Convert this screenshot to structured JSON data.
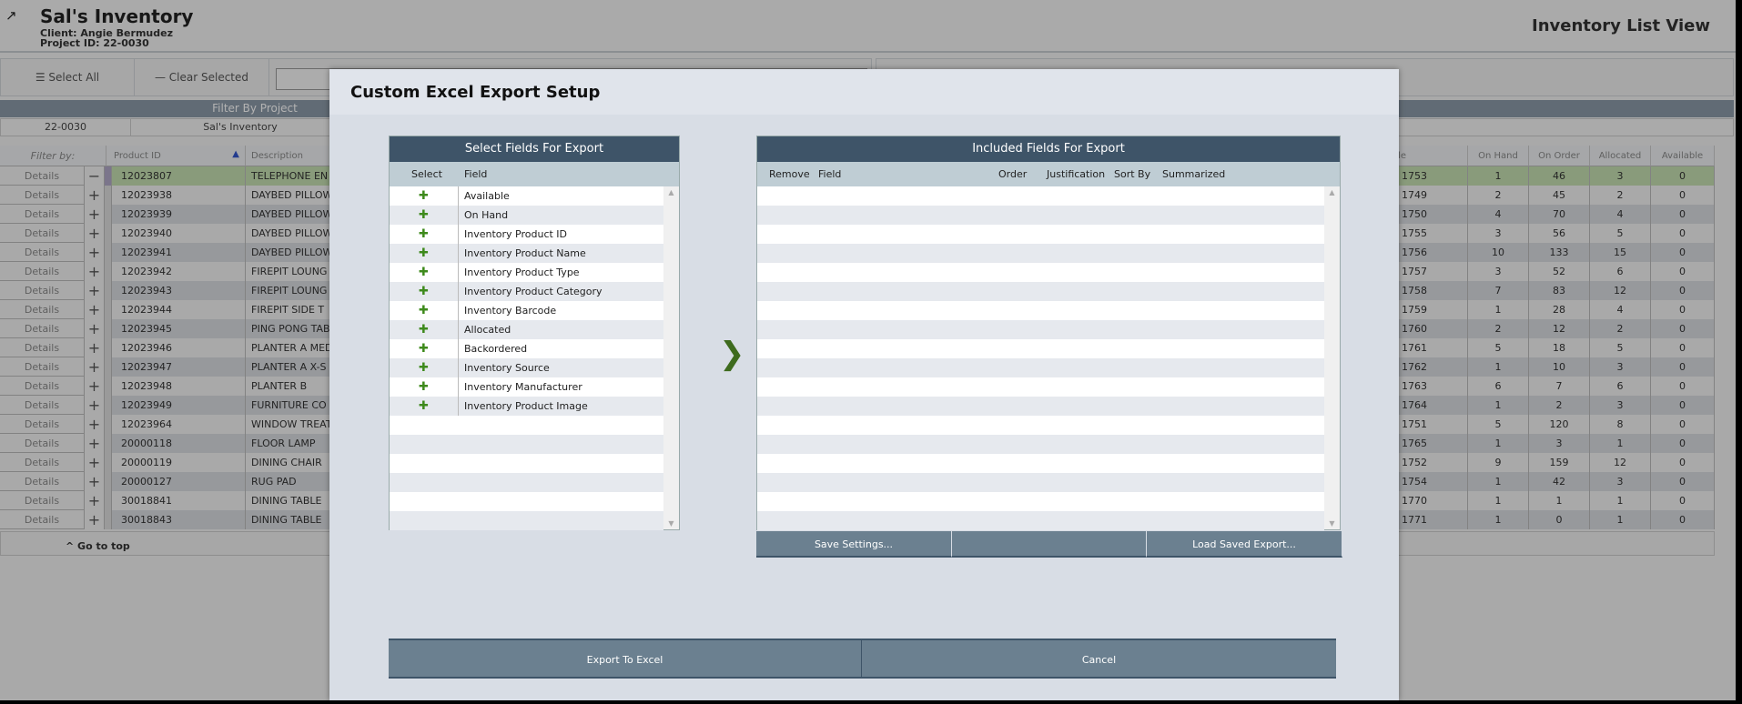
{
  "header": {
    "title": "Sal's Inventory",
    "client": "Client: Angie Bermudez",
    "project": "Project ID: 22-0030",
    "view_title": "Inventory List View"
  },
  "toolbar": {
    "select_all": "Select All",
    "clear_selected": "Clear Selected"
  },
  "filter": {
    "label": "Filter By Project",
    "project_id": "22-0030",
    "project_name": "Sal's Inventory"
  },
  "grid": {
    "headers": {
      "filter_by": "Filter by:",
      "product_id": "Product ID",
      "description": "Description",
      "barcode": "Barcode",
      "on_hand": "On Hand",
      "on_order": "On Order",
      "allocated": "Allocated",
      "available": "Available"
    },
    "details_label": "Details",
    "rows": [
      {
        "id": "12023807",
        "desc": "TELEPHONE EN",
        "code": "1753",
        "oh": "1",
        "oo": "46",
        "al": "3",
        "av": "0",
        "selected": true
      },
      {
        "id": "12023938",
        "desc": "DAYBED PILLOW",
        "code": "1749",
        "oh": "2",
        "oo": "45",
        "al": "2",
        "av": "0"
      },
      {
        "id": "12023939",
        "desc": "DAYBED PILLOW",
        "code": "1750",
        "oh": "4",
        "oo": "70",
        "al": "4",
        "av": "0"
      },
      {
        "id": "12023940",
        "desc": "DAYBED PILLOW",
        "code": "1755",
        "oh": "3",
        "oo": "56",
        "al": "5",
        "av": "0"
      },
      {
        "id": "12023941",
        "desc": "DAYBED PILLOW",
        "code": "1756",
        "oh": "10",
        "oo": "133",
        "al": "15",
        "av": "0"
      },
      {
        "id": "12023942",
        "desc": "FIREPIT LOUNG",
        "code": "1757",
        "oh": "3",
        "oo": "52",
        "al": "6",
        "av": "0"
      },
      {
        "id": "12023943",
        "desc": "FIREPIT LOUNG",
        "code": "1758",
        "oh": "7",
        "oo": "83",
        "al": "12",
        "av": "0"
      },
      {
        "id": "12023944",
        "desc": "FIREPIT SIDE T",
        "code": "1759",
        "oh": "1",
        "oo": "28",
        "al": "4",
        "av": "0"
      },
      {
        "id": "12023945",
        "desc": "PING PONG TAB",
        "code": "1760",
        "oh": "2",
        "oo": "12",
        "al": "2",
        "av": "0"
      },
      {
        "id": "12023946",
        "desc": "PLANTER A MED",
        "code": "1761",
        "oh": "5",
        "oo": "18",
        "al": "5",
        "av": "0"
      },
      {
        "id": "12023947",
        "desc": "PLANTER A X-S",
        "code": "1762",
        "oh": "1",
        "oo": "10",
        "al": "3",
        "av": "0"
      },
      {
        "id": "12023948",
        "desc": "PLANTER B",
        "code": "1763",
        "oh": "6",
        "oo": "7",
        "al": "6",
        "av": "0"
      },
      {
        "id": "12023949",
        "desc": "FURNITURE CO",
        "code": "1764",
        "oh": "1",
        "oo": "2",
        "al": "3",
        "av": "0"
      },
      {
        "id": "12023964",
        "desc": "WINDOW TREAT",
        "code": "1751",
        "oh": "5",
        "oo": "120",
        "al": "8",
        "av": "0"
      },
      {
        "id": "20000118",
        "desc": "FLOOR LAMP",
        "code": "1765",
        "oh": "1",
        "oo": "3",
        "al": "1",
        "av": "0"
      },
      {
        "id": "20000119",
        "desc": "DINING CHAIR",
        "code": "1752",
        "oh": "9",
        "oo": "159",
        "al": "12",
        "av": "0"
      },
      {
        "id": "20000127",
        "desc": "RUG PAD",
        "code": "1754",
        "oh": "1",
        "oo": "42",
        "al": "3",
        "av": "0"
      },
      {
        "id": "30018841",
        "desc": "DINING TABLE",
        "code": "1770",
        "oh": "1",
        "oo": "1",
        "al": "1",
        "av": "0"
      },
      {
        "id": "30018843",
        "desc": "DINING TABLE",
        "code": "1771",
        "oh": "1",
        "oo": "0",
        "al": "1",
        "av": "0"
      }
    ],
    "go_to_top": "^ Go to top"
  },
  "modal": {
    "title": "Custom Excel Export Setup",
    "select_panel": {
      "title": "Select Fields For Export",
      "col_select": "Select",
      "col_field": "Field",
      "fields": [
        "Available",
        "On Hand",
        "Inventory Product ID",
        "Inventory Product Name",
        "Inventory Product Type",
        "Inventory Product Category",
        "Inventory Barcode",
        "Allocated",
        "Backordered",
        "Inventory Source",
        "Inventory Manufacturer",
        "Inventory Product Image"
      ]
    },
    "included_panel": {
      "title": "Included Fields For Export",
      "cols": {
        "remove": "Remove",
        "field": "Field",
        "order": "Order",
        "justification": "Justification",
        "sort_by": "Sort By",
        "summarized": "Summarized"
      },
      "save_settings": "Save Settings...",
      "load_saved": "Load Saved Export..."
    },
    "export_button": "Export To Excel",
    "cancel_button": "Cancel"
  },
  "colors": {
    "panel_header": "#3e5468",
    "button": "#6b8090",
    "add_icon": "#3e8a1c",
    "selected_row": "#c5dfb0"
  }
}
